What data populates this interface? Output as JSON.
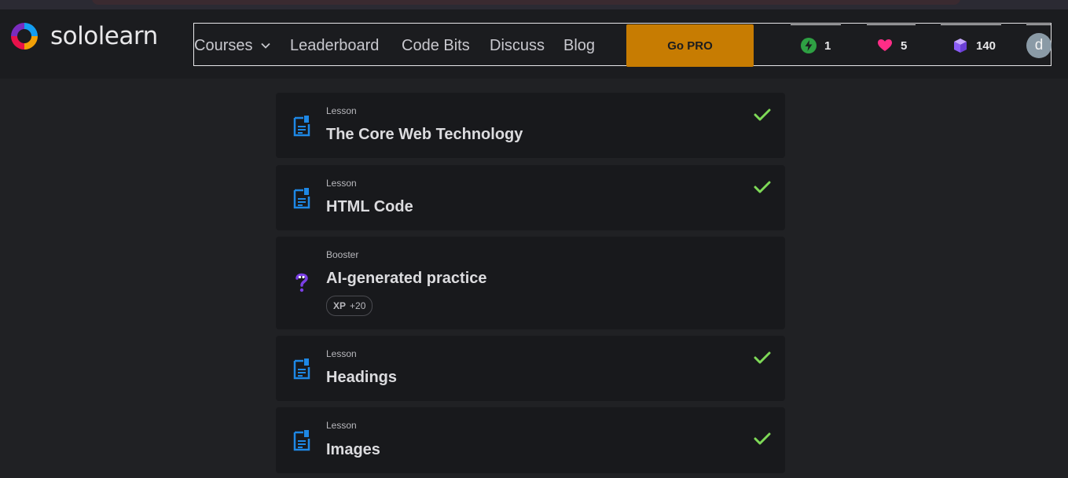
{
  "brand": {
    "name": "sololearn"
  },
  "nav": {
    "courses_label": "Courses",
    "leaderboard_label": "Leaderboard",
    "codebits_label": "Code Bits",
    "discuss_label": "Discuss",
    "blog_label": "Blog",
    "gopro_label": "Go PRO"
  },
  "stats": {
    "streak": "1",
    "hearts": "5",
    "gems": "140"
  },
  "user": {
    "avatar_letter": "d"
  },
  "items": [
    {
      "type": "Lesson",
      "title": "The Core Web Technology",
      "completed": true
    },
    {
      "type": "Lesson",
      "title": "HTML Code",
      "completed": true
    },
    {
      "type": "Booster",
      "title": "AI-generated practice",
      "completed": false,
      "xp_label": "XP",
      "xp_value": "+20"
    },
    {
      "type": "Lesson",
      "title": "Headings",
      "completed": true
    },
    {
      "type": "Lesson",
      "title": "Images",
      "completed": true
    }
  ],
  "colors": {
    "accent_pro": "#c77c02",
    "check_green": "#7ed957",
    "lesson_icon_blue": "#1e88e5",
    "booster_purple": "#7b3fe4"
  }
}
